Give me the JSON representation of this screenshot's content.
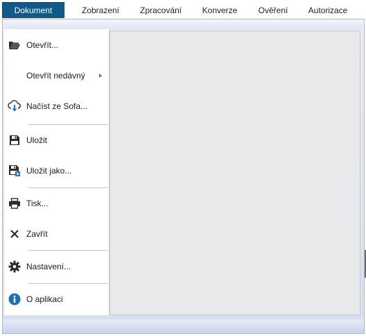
{
  "ribbon": {
    "tabs": [
      {
        "label": "Dokument",
        "active": true
      },
      {
        "label": "Zobrazení"
      },
      {
        "label": "Zpracování"
      },
      {
        "label": "Konverze"
      },
      {
        "label": "Ověření"
      },
      {
        "label": "Autorizace"
      }
    ]
  },
  "menu": {
    "items": [
      {
        "label": "Otevřít...",
        "icon": "folder-open-icon"
      },
      {
        "label": "Otevřít nedávný",
        "icon": "",
        "submenu": true
      },
      {
        "label": "Načíst ze Sofa...",
        "icon": "cloud-download-icon"
      },
      {
        "label": "Uložit",
        "icon": "save-icon"
      },
      {
        "label": "Uložit jako...",
        "icon": "save-as-icon"
      },
      {
        "label": "Tisk...",
        "icon": "printer-icon"
      },
      {
        "label": "Zavřít",
        "icon": "close-icon"
      },
      {
        "label": "Nastavení...",
        "icon": "gear-icon"
      },
      {
        "label": "O aplikaci",
        "icon": "info-icon"
      }
    ]
  },
  "colors": {
    "file_tab_bg": "#0f5a8a",
    "info_icon": "#1f6fb5",
    "content_bg": "#e9e9ec"
  }
}
